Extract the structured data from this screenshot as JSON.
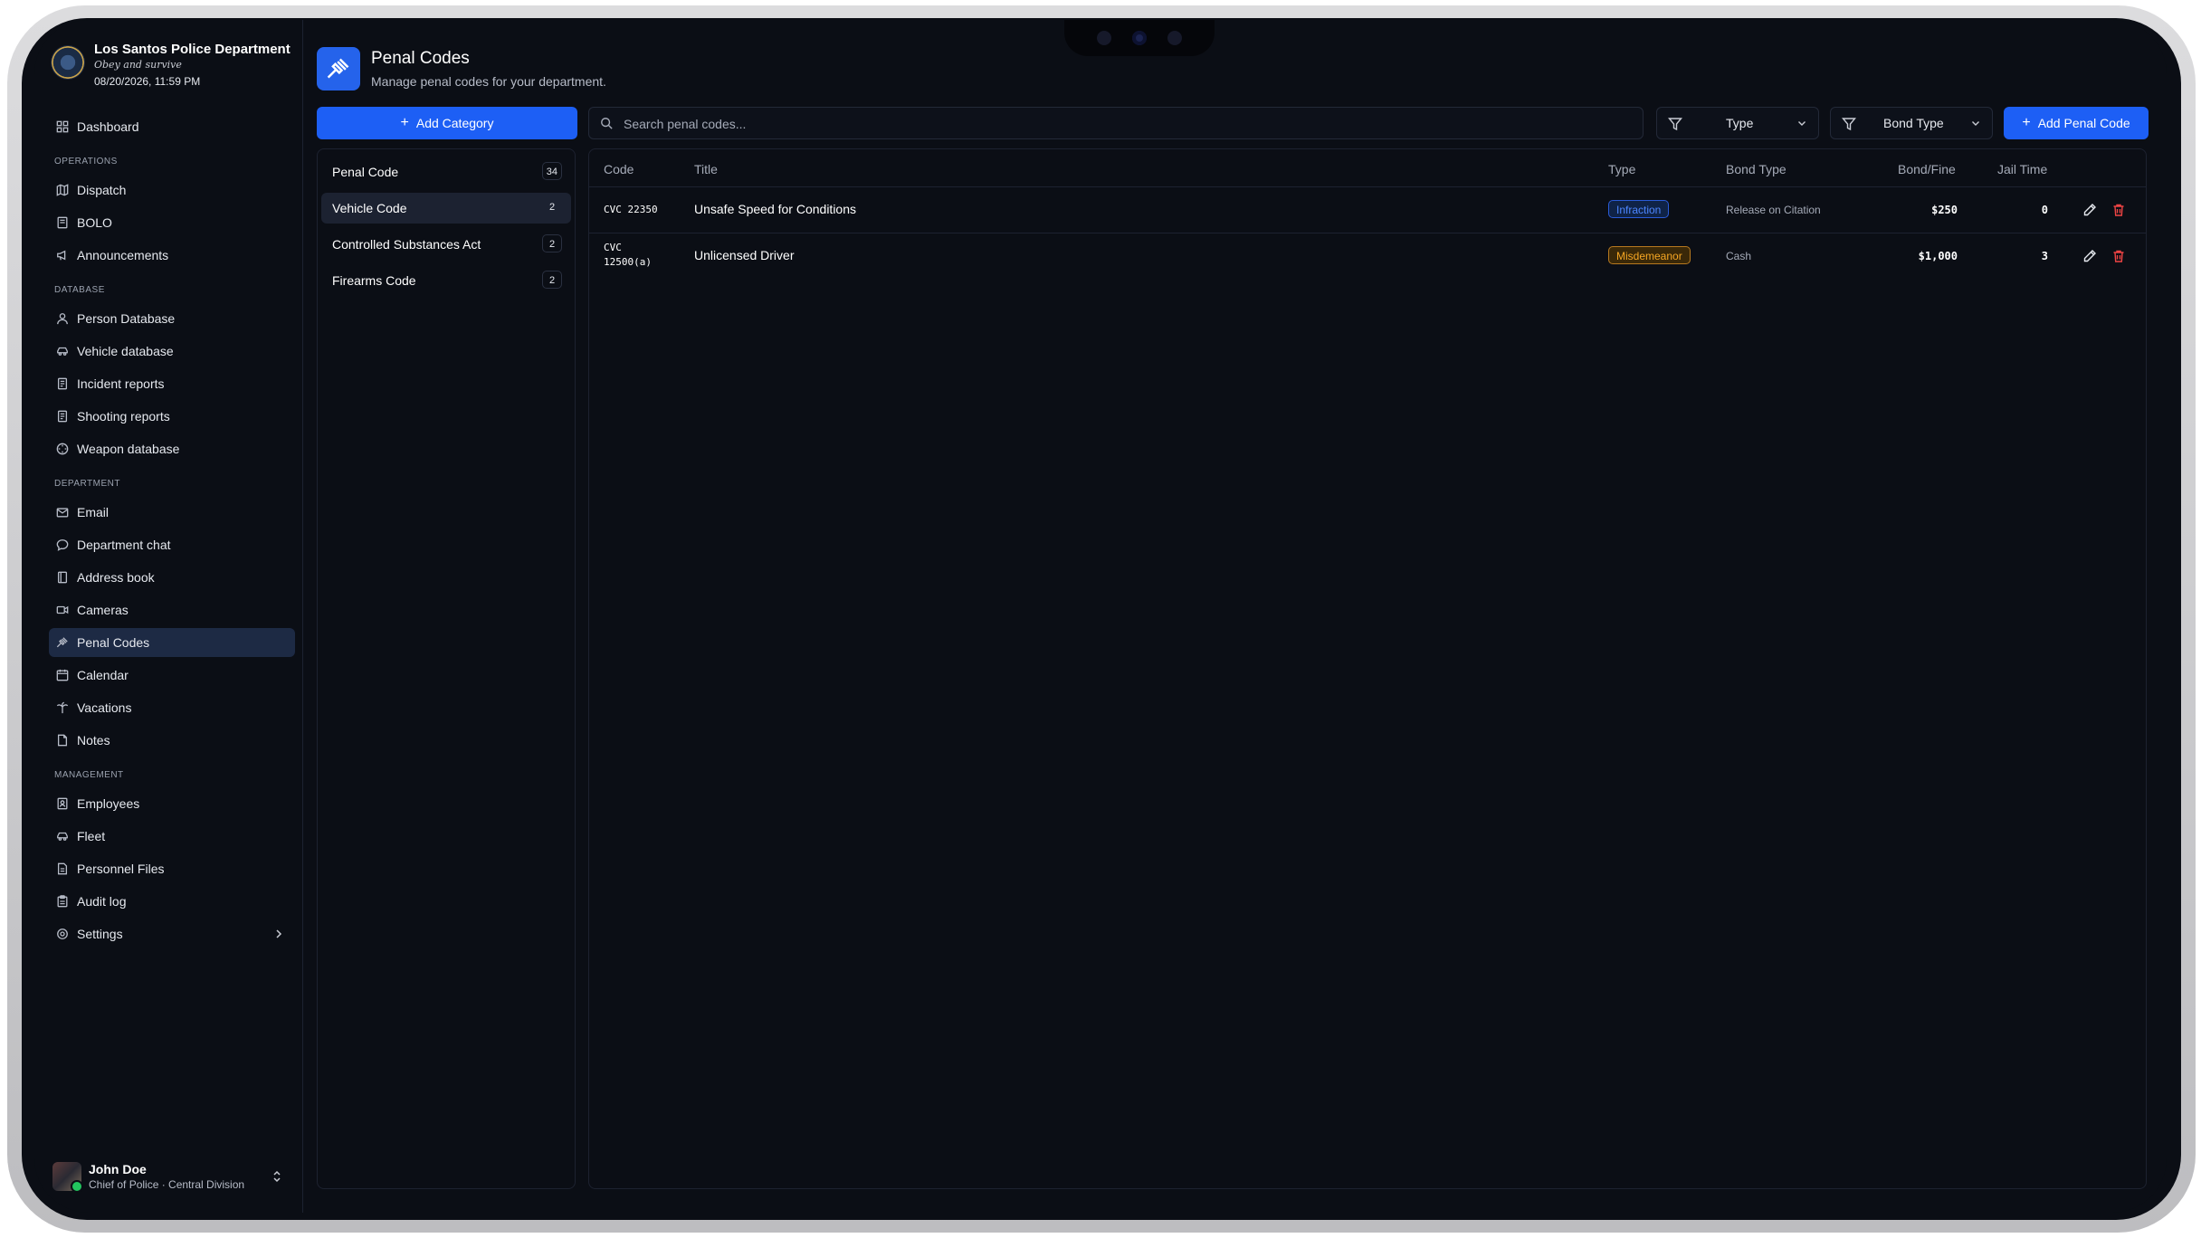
{
  "colors": {
    "accent": "#1d5ff5",
    "background": "#0b0e15",
    "infraction": "#4d86ff",
    "misdemeanor": "#f5a623",
    "delete": "#ef4444"
  },
  "org": {
    "name": "Los Santos Police Department",
    "motto": "Obey and survive",
    "datetime": "08/20/2026, 11:59 PM"
  },
  "sidebar": {
    "dashboard": {
      "label": "Dashboard",
      "icon": "dashboard-icon"
    },
    "sections": [
      {
        "title": "OPERATIONS",
        "items": [
          {
            "label": "Dispatch",
            "icon": "map-icon"
          },
          {
            "label": "BOLO",
            "icon": "book-icon"
          },
          {
            "label": "Announcements",
            "icon": "megaphone-icon"
          }
        ]
      },
      {
        "title": "DATABASE",
        "items": [
          {
            "label": "Person Database",
            "icon": "person-icon"
          },
          {
            "label": "Vehicle database",
            "icon": "car-icon"
          },
          {
            "label": "Incident reports",
            "icon": "report-icon"
          },
          {
            "label": "Shooting reports",
            "icon": "report-icon"
          },
          {
            "label": "Weapon database",
            "icon": "target-icon"
          }
        ]
      },
      {
        "title": "DEPARTMENT",
        "items": [
          {
            "label": "Email",
            "icon": "mail-icon"
          },
          {
            "label": "Department chat",
            "icon": "chat-icon"
          },
          {
            "label": "Address book",
            "icon": "address-book-icon"
          },
          {
            "label": "Cameras",
            "icon": "camera-icon"
          },
          {
            "label": "Penal Codes",
            "icon": "gavel-icon",
            "active": true
          },
          {
            "label": "Calendar",
            "icon": "calendar-icon"
          },
          {
            "label": "Vacations",
            "icon": "palm-icon"
          },
          {
            "label": "Notes",
            "icon": "note-icon"
          }
        ]
      },
      {
        "title": "MANAGEMENT",
        "items": [
          {
            "label": "Employees",
            "icon": "id-card-icon"
          },
          {
            "label": "Fleet",
            "icon": "car-icon"
          },
          {
            "label": "Personnel Files",
            "icon": "file-icon"
          },
          {
            "label": "Audit log",
            "icon": "clipboard-icon"
          },
          {
            "label": "Settings",
            "icon": "gear-icon"
          }
        ]
      }
    ]
  },
  "user": {
    "name": "John Doe",
    "role": "Chief of Police · Central Division"
  },
  "header": {
    "title": "Penal Codes",
    "subtitle": "Manage penal codes for your department."
  },
  "toolbar": {
    "add_category": "Add Category",
    "search_placeholder": "Search penal codes...",
    "type_filter": "Type",
    "bond_filter": "Bond Type",
    "add_penal_code": "Add Penal Code"
  },
  "categories": [
    {
      "name": "Penal Code",
      "count": "34"
    },
    {
      "name": "Vehicle Code",
      "count": "2",
      "active": true
    },
    {
      "name": "Controlled Substances Act",
      "count": "2"
    },
    {
      "name": "Firearms Code",
      "count": "2"
    }
  ],
  "table": {
    "headers": {
      "code": "Code",
      "title": "Title",
      "type": "Type",
      "bond_type": "Bond Type",
      "bond_fine": "Bond/Fine",
      "jail_time": "Jail Time"
    },
    "rows": [
      {
        "code_line1": "CVC 22350",
        "code_line2": "",
        "title": "Unsafe Speed for Conditions",
        "type": "Infraction",
        "bond_type": "Release on Citation",
        "bond_fine": "$250",
        "jail_time": "0"
      },
      {
        "code_line1": "CVC",
        "code_line2": "12500(a)",
        "title": "Unlicensed Driver",
        "type": "Misdemeanor",
        "bond_type": "Cash",
        "bond_fine": "$1,000",
        "jail_time": "3"
      }
    ]
  }
}
